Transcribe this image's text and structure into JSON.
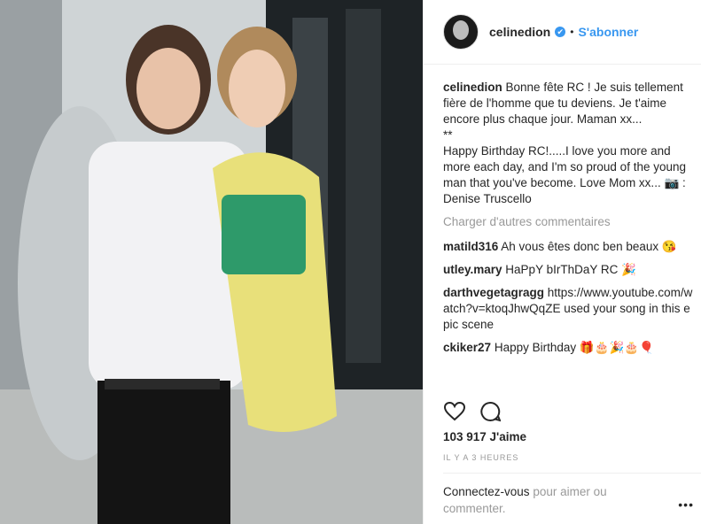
{
  "header": {
    "username": "celinedion",
    "verified_glyph": "✔",
    "separator": "•",
    "follow_label": "S'abonner"
  },
  "caption": {
    "username": "celinedion",
    "text": "Bonne fête RC ! Je suis tellement fière de l'homme que tu deviens. Je t'aime encore plus chaque jour.  Maman xx...\n**\nHappy Birthday RC!.....I love you more and more each day, and I'm so proud of the young man that you've become.  Love Mom xx... 📷 : Denise Truscello"
  },
  "load_more_label": "Charger d'autres commentaires",
  "comments": [
    {
      "username": "matild316",
      "text": "Ah vous êtes donc ben beaux 😘"
    },
    {
      "username": "utley.mary",
      "text": "HaPpY bIrThDaY RC 🎉"
    },
    {
      "username": "darthvegetagragg",
      "text": "https://www.youtube.com/watch?v=ktoqJhwQqZE used your song in this epic scene"
    },
    {
      "username": "ckiker27",
      "text": "Happy Birthday 🎁🎂🎉🎂🎈"
    }
  ],
  "likes": "103 917 J'aime",
  "timestamp": "IL Y A 3 HEURES",
  "login_prompt": {
    "link": "Connectez-vous",
    "rest": " pour aimer ou commenter."
  },
  "more_glyph": "•••",
  "icons": [
    "heart-icon",
    "comment-icon",
    "more-options-icon",
    "verified-icon"
  ],
  "colors": {
    "accent": "#3897f0",
    "text": "#262626",
    "muted": "#999999",
    "border": "#efefef"
  }
}
